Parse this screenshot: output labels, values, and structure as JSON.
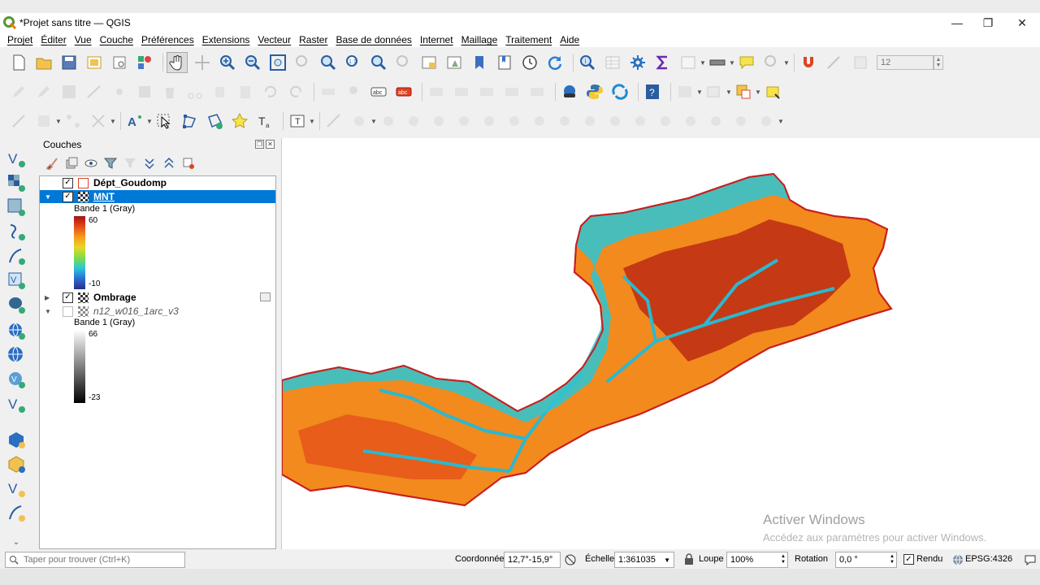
{
  "window": {
    "top_strip": "",
    "title": "*Projet sans titre — QGIS",
    "minimize": "—",
    "maximize": "❐",
    "close": "✕"
  },
  "menu": [
    "Projet",
    "Éditer",
    "Vue",
    "Couche",
    "Préférences",
    "Extensions",
    "Vecteur",
    "Raster",
    "Base de données",
    "Internet",
    "Maillage",
    "Traitement",
    "Aide"
  ],
  "toolbar1": {
    "scale_field": "12"
  },
  "layers_panel": {
    "title": "Couches",
    "layers": [
      {
        "name": "Dépt_Goudomp",
        "checked": true,
        "selected": false
      },
      {
        "name": "MNT",
        "checked": true,
        "selected": true,
        "legend_band": "Bande 1 (Gray)",
        "max": "60",
        "min": "-10"
      },
      {
        "name": "Ombrage",
        "checked": true,
        "selected": false
      },
      {
        "name": "n12_w016_1arc_v3",
        "checked": false,
        "selected": false,
        "legend_band": "Bande 1 (Gray)",
        "max": "66",
        "min": "-23"
      }
    ]
  },
  "map": {
    "watermark_title": "Activer Windows",
    "watermark_sub": "Accédez aux paramètres pour activer Windows.",
    "outline_color": "#d42020"
  },
  "statusbar": {
    "locator_placeholder": "Taper pour trouver (Ctrl+K)",
    "coord_label": "Coordonnée",
    "coord_value": "12,7°-15,9°",
    "scale_label": "Échelle",
    "scale_value": "1:361035",
    "magnifier_label": "Loupe",
    "magnifier_value": "100%",
    "rotation_label": "Rotation",
    "rotation_value": "0,0 °",
    "render_label": "Rendu",
    "crs": "EPSG:4326"
  }
}
